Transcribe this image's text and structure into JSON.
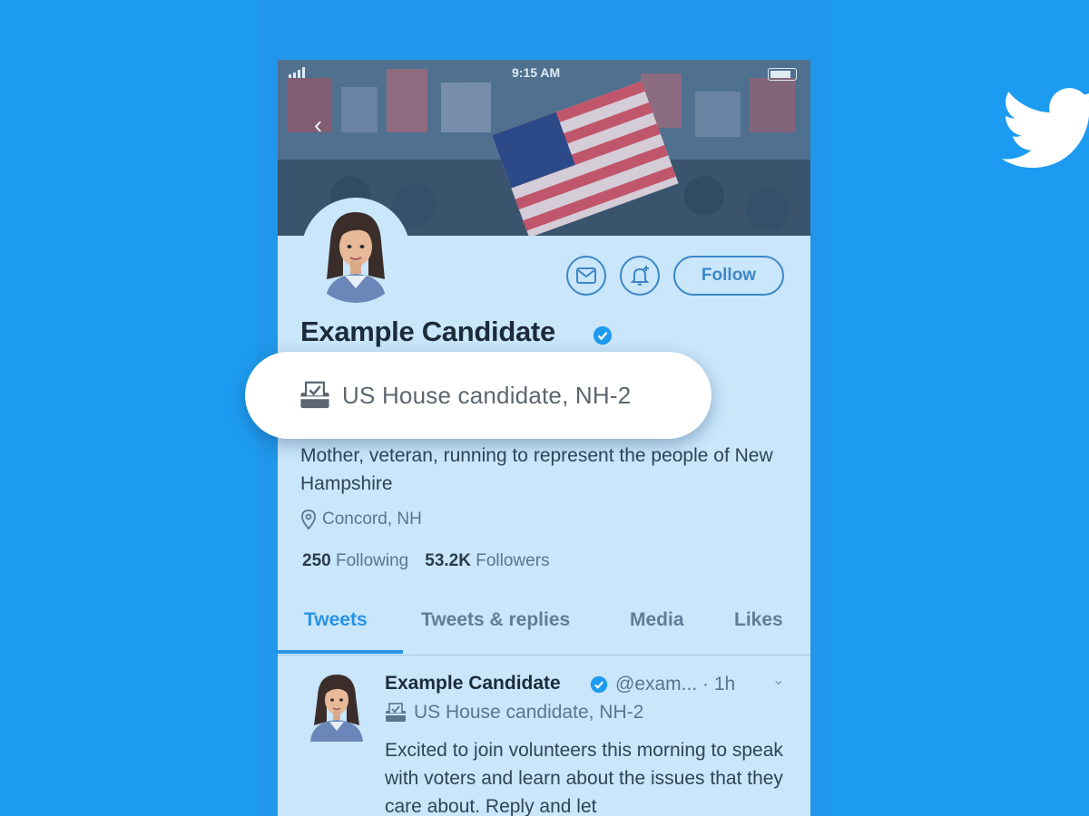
{
  "status_bar": {
    "time": "9:15 AM"
  },
  "profile": {
    "name": "Example Candidate",
    "label": "US House candidate, NH-2",
    "bio": "Mother, veteran, running to represent the people of New Hampshire",
    "location": "Concord, NH",
    "following_count": "250",
    "following_label": "Following",
    "followers_count": "53.2K",
    "followers_label": "Followers",
    "follow_label": "Follow"
  },
  "tabs": [
    {
      "label": "Tweets"
    },
    {
      "label": "Tweets & replies"
    },
    {
      "label": "Media"
    },
    {
      "label": "Likes"
    }
  ],
  "tweet": {
    "name": "Example Candidate",
    "handle": "@exam... · 1h",
    "label": "US House candidate, NH-2",
    "text": "Excited to join volunteers this morning to speak with voters and learn about the issues that they care about. Reply and let"
  },
  "colors": {
    "background": "#1d9bf0",
    "accent": "#2a93e3",
    "verified": "#1d9bf0"
  },
  "icons": [
    "twitter-bird-icon",
    "envelope-icon",
    "bell-plus-icon",
    "verified-badge-icon",
    "ballot-box-icon",
    "location-pin-icon",
    "chevron-down-icon",
    "back-arrow-icon"
  ]
}
